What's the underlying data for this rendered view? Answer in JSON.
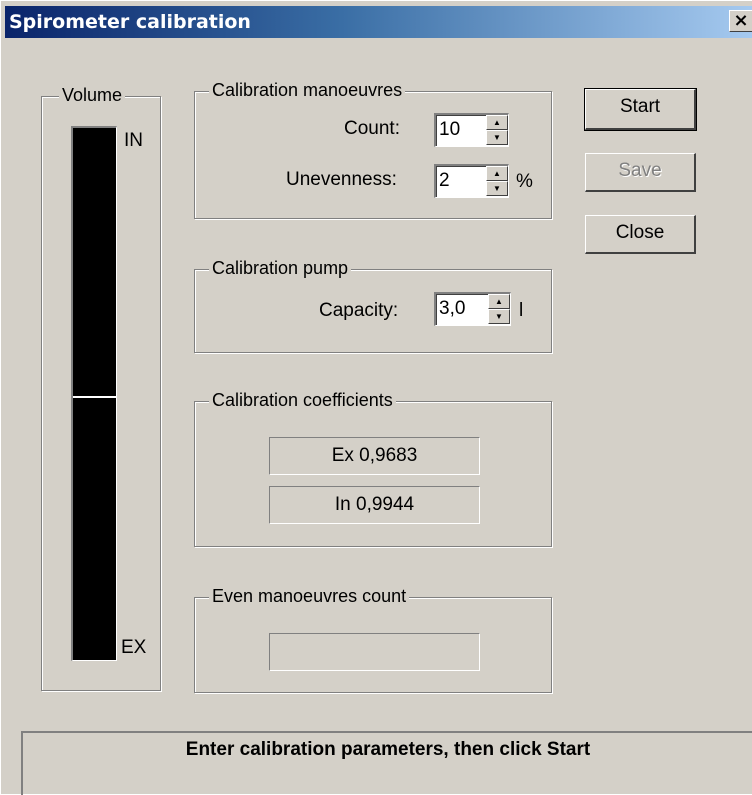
{
  "window": {
    "title": "Spirometer calibration",
    "close_glyph": "×"
  },
  "volume": {
    "legend": "Volume",
    "top_label": "IN",
    "bottom_label": "EX",
    "level_fraction": 0.504
  },
  "manoeuvres": {
    "legend": "Calibration manoeuvres",
    "count_label": "Count:",
    "count_value": "10",
    "unevenness_label": "Unevenness:",
    "unevenness_value": "2",
    "unevenness_unit": "%"
  },
  "pump": {
    "legend": "Calibration pump",
    "capacity_label": "Capacity:",
    "capacity_value": "3,0",
    "capacity_unit": "l"
  },
  "coefficients": {
    "legend": "Calibration coefficients",
    "ex": "Ex  0,9683",
    "in": "In  0,9944"
  },
  "even": {
    "legend": "Even manoeuvres count",
    "value": ""
  },
  "buttons": {
    "start": "Start",
    "save": "Save",
    "close": "Close"
  },
  "status": {
    "text": "Enter calibration parameters, then click Start"
  }
}
